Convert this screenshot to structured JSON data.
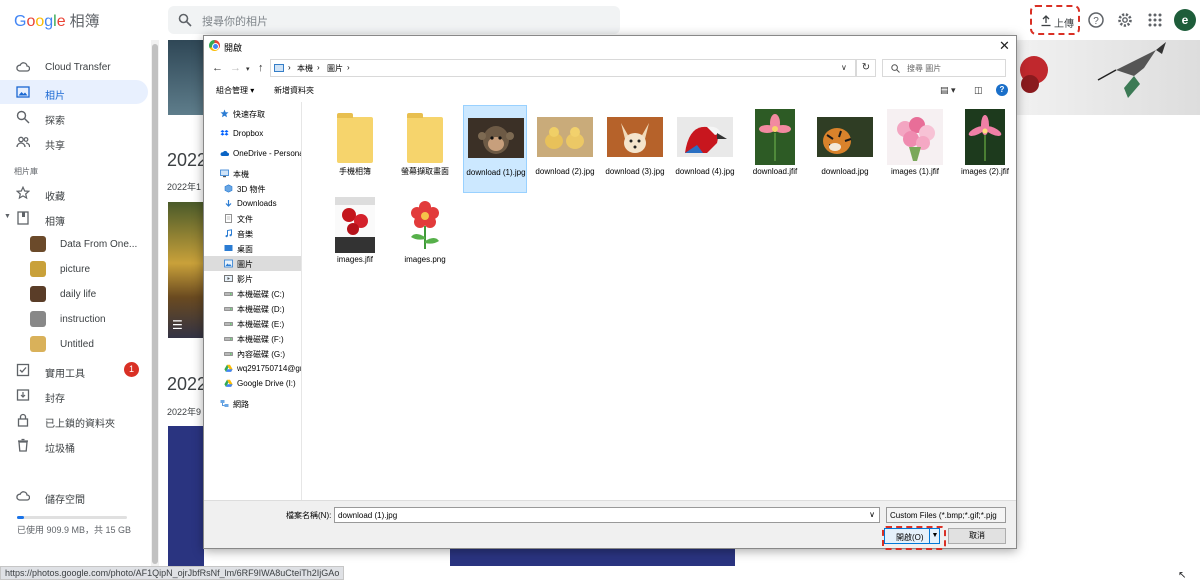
{
  "header": {
    "logo_google": "Google",
    "logo_product": "相簿",
    "search_placeholder": "搜尋你的相片",
    "upload_label": "上傳",
    "avatar_letter": "e"
  },
  "sidebar": {
    "items": [
      {
        "label": "Cloud Transfer",
        "icon": "cloud-transfer-icon"
      },
      {
        "label": "相片",
        "icon": "photo-icon"
      },
      {
        "label": "探索",
        "icon": "search-icon"
      },
      {
        "label": "共享",
        "icon": "people-icon"
      }
    ],
    "section_label": "相片庫",
    "library_items": [
      {
        "label": "收藏",
        "icon": "star-icon"
      },
      {
        "label": "相簿",
        "icon": "album-icon"
      }
    ],
    "albums": [
      {
        "label": "Data From One...",
        "color": "#6b4a2a"
      },
      {
        "label": "picture",
        "color": "#c9a13a"
      },
      {
        "label": "daily life",
        "color": "#5a3d28"
      },
      {
        "label": "instruction",
        "color": "#888888"
      },
      {
        "label": "Untitled",
        "color": "#d9b15a"
      }
    ],
    "tools": [
      {
        "label": "實用工具",
        "icon": "utilities-icon",
        "badge": "1"
      },
      {
        "label": "封存",
        "icon": "archive-icon"
      },
      {
        "label": "已上鎖的資料夾",
        "icon": "lock-icon"
      },
      {
        "label": "垃圾桶",
        "icon": "trash-icon"
      }
    ],
    "storage_label": "儲存空間",
    "storage_text": "已使用 909.9 MB，共 15 GB",
    "storage_fraction": 0.06
  },
  "main": {
    "year1": "2022",
    "date1": "2022年1",
    "year2": "2022",
    "date2": "2022年9"
  },
  "status_url": "https://photos.google.com/photo/AF1QipN_ojrJbfRsNf_lm/6RF9IWA8uCteiTh2IjGAo",
  "dialog": {
    "title": "開啟",
    "breadcrumb": [
      "本機",
      "圖片"
    ],
    "search_placeholder": "搜尋 圖片",
    "toolbar": {
      "organize": "組合管理 ▾",
      "new_folder": "新增資料夾"
    },
    "tree": [
      {
        "label": "快速存取",
        "icon": "star-icon",
        "indent": 0
      },
      {
        "label": "Dropbox",
        "icon": "dropbox-icon",
        "indent": 0
      },
      {
        "label": "OneDrive - Personal",
        "icon": "onedrive-icon",
        "indent": 0
      },
      {
        "label": "本機",
        "icon": "pc-icon",
        "indent": 0
      },
      {
        "label": "3D 物件",
        "icon": "3d-objects-icon",
        "indent": 1
      },
      {
        "label": "Downloads",
        "icon": "download-icon",
        "indent": 1
      },
      {
        "label": "文件",
        "icon": "document-icon",
        "indent": 1
      },
      {
        "label": "音樂",
        "icon": "music-icon",
        "indent": 1
      },
      {
        "label": "桌面",
        "icon": "desktop-icon",
        "indent": 1
      },
      {
        "label": "圖片",
        "icon": "pictures-icon",
        "indent": 1,
        "selected": true
      },
      {
        "label": "影片",
        "icon": "video-icon",
        "indent": 1
      },
      {
        "label": "本機磁碟 (C:)",
        "icon": "drive-icon",
        "indent": 1
      },
      {
        "label": "本機磁碟 (D:)",
        "icon": "drive-icon",
        "indent": 1
      },
      {
        "label": "本機磁碟 (E:)",
        "icon": "drive-icon",
        "indent": 1
      },
      {
        "label": "本機磁碟 (F:)",
        "icon": "drive-icon",
        "indent": 1
      },
      {
        "label": "內容磁碟 (G:)",
        "icon": "drive-icon",
        "indent": 1
      },
      {
        "label": "wq291750714@gm",
        "icon": "google-drive-icon",
        "indent": 1
      },
      {
        "label": "Google Drive (I:)",
        "icon": "google-drive-icon",
        "indent": 1
      },
      {
        "label": "網路",
        "icon": "network-icon",
        "indent": 0
      }
    ],
    "files": [
      {
        "name": "手機相簿",
        "kind": "folder"
      },
      {
        "name": "螢幕擷取畫面",
        "kind": "folder"
      },
      {
        "name": "download (1).jpg",
        "kind": "monkey",
        "selected": true
      },
      {
        "name": "download (2).jpg",
        "kind": "ducklings"
      },
      {
        "name": "download (3).jpg",
        "kind": "fox"
      },
      {
        "name": "download (4).jpg",
        "kind": "parrot"
      },
      {
        "name": "download.jfif",
        "kind": "pink-flower"
      },
      {
        "name": "download.jpg",
        "kind": "tiger"
      },
      {
        "name": "images (1).jfif",
        "kind": "bouquet"
      },
      {
        "name": "images (2).jfif",
        "kind": "lily"
      },
      {
        "name": "images.jfif",
        "kind": "roses"
      },
      {
        "name": "images.png",
        "kind": "red-flower-drawing"
      }
    ],
    "filename_label": "檔案名稱(N):",
    "filename_value": "download (1).jpg",
    "filetype_value": "Custom Files (*.bmp;*.gif;*.pjg",
    "open_label": "開啟(O)",
    "cancel_label": "取消"
  }
}
